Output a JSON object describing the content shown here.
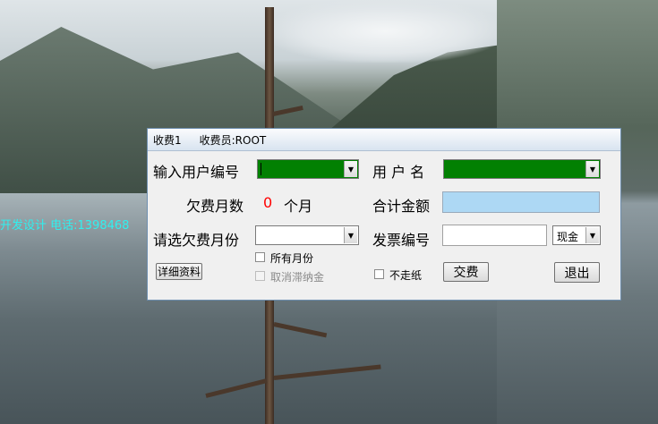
{
  "background": {
    "overlay_text": "开发设计 电话:1398468",
    "overlay_color": "#2ff0ef"
  },
  "dialog": {
    "title_left": "收费1",
    "title_right": "收费员:ROOT",
    "user_no_label": "输入用户编号",
    "user_name_label": "用 户 名",
    "arrears_label": "欠费月数",
    "arrears_value": "0",
    "arrears_unit": "个月",
    "total_label": "合计金额",
    "select_month_label": "请选欠费月份",
    "invoice_label": "发票编号",
    "payment_method": "现金",
    "details_button": "详细资料",
    "all_months_label": "所有月份",
    "cancel_late_fee_label": "取消滞纳金",
    "no_paper_label": "不走纸",
    "pay_button": "交费",
    "exit_button": "退出",
    "green_color": "#028002",
    "highlight_color": "#add8f4",
    "red_color": "#ff0000"
  }
}
